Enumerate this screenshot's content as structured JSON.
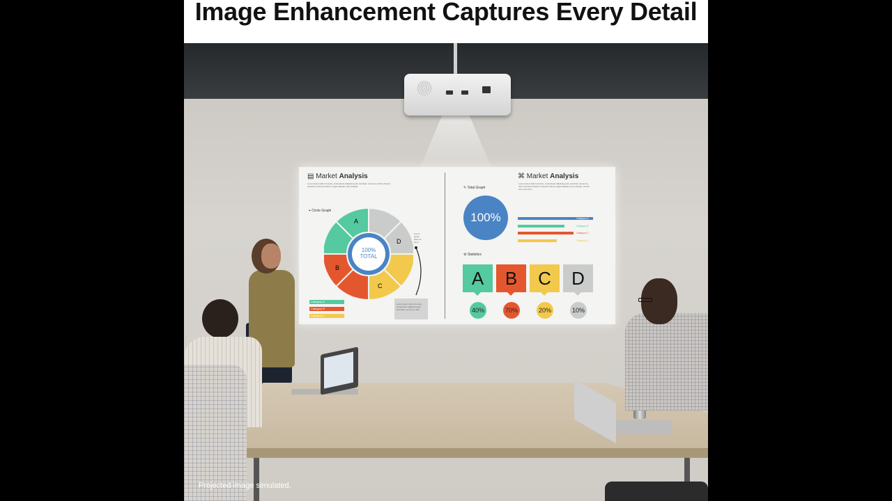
{
  "headline": "Image Enhancement Captures Every Detail",
  "caption": "Projected image simulated.",
  "projected_slide": {
    "left_panel": {
      "title_light": "Market",
      "title_bold": "Analysis",
      "lorem": "Lorem ipsum dolor sit amet, consectetur adipiscing elit, sed diam nonummy nibh euismod tincidunt ut laoreet dolore magna aliquam erat volutpat",
      "circle_graph_label": "Circle Graph",
      "donut_center_top": "100%",
      "donut_center_bottom": "TOTAL",
      "segments": [
        {
          "label": "A",
          "color": "#55c9a0"
        },
        {
          "label": "D",
          "color": "#c9cccb"
        },
        {
          "label": "C",
          "color": "#f2c94c"
        },
        {
          "label": "B",
          "color": "#e4572e"
        }
      ],
      "side_note": "Lorem ipsum dolor sit amet",
      "box_note": "Lorem ipsum dolor sit amet, consectetur adipiscing elit, sed diam nonummy nibh",
      "legend": [
        "Category A",
        "Category B",
        "Category C"
      ]
    },
    "right_panel": {
      "title_light": "Market",
      "title_bold": "Analysis",
      "lorem": "Lorem ipsum dolor sit amet, consectetur adipiscing elit, sed diam nonummy nibh euismod tincidunt ut laoreet dolore magna aliquam erat volutpat. Ut wisi enim ad minim",
      "total_graph_label": "Total Graph",
      "total_value": "100%",
      "bar_legend": [
        {
          "label": "Category A",
          "color": "#4a84c4",
          "fraction": 1.0
        },
        {
          "label": "Category B",
          "color": "#55c9a0",
          "fraction": 0.62
        },
        {
          "label": "Category C",
          "color": "#e4572e",
          "fraction": 0.74
        },
        {
          "label": "Category D",
          "color": "#f2c94c",
          "fraction": 0.52
        }
      ],
      "statistics_label": "Statistics",
      "tiles": [
        {
          "letter": "A",
          "percent": "40%",
          "color": "#55c9a0"
        },
        {
          "letter": "B",
          "percent": "70%",
          "color": "#e4572e"
        },
        {
          "letter": "C",
          "percent": "20%",
          "color": "#f2c94c"
        },
        {
          "letter": "D",
          "percent": "10%",
          "color": "#c9cccb"
        }
      ]
    }
  }
}
